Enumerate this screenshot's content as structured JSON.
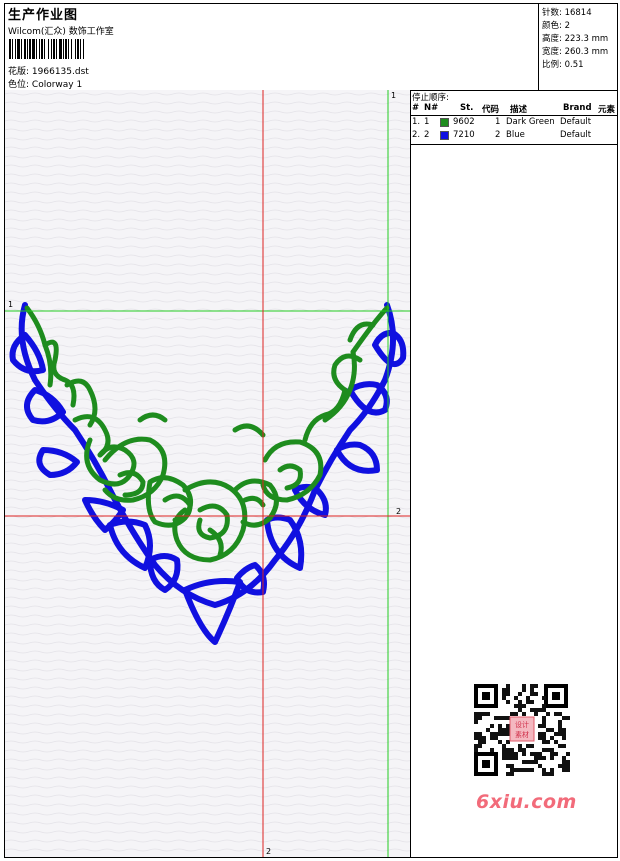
{
  "header": {
    "title": "生产作业图",
    "company": "Wilcom(汇众) 数饰工作室",
    "design_label": "花版:",
    "design_value": "1966135.dst",
    "colorway_label": "色位:",
    "colorway_value": "Colorway 1"
  },
  "stats": {
    "stitches_label": "针数:",
    "stitches_value": "16814",
    "colors_label": "颜色:",
    "colors_value": "2",
    "height_label": "高度:",
    "height_value": "223.3 mm",
    "width_label": "宽度:",
    "width_value": "260.3 mm",
    "scale_label": "比例:",
    "scale_value": "0.51"
  },
  "stop_sequence": {
    "label": "停止顺序:",
    "columns": [
      "#",
      "N#",
      "St.",
      "代码",
      "描述",
      "Brand",
      "元素"
    ],
    "rows": [
      {
        "num": "1.",
        "needle": "1",
        "color": "#1e8c1e",
        "stitch": "9602",
        "code": "1",
        "desc": "Dark Green",
        "brand": "Default"
      },
      {
        "num": "2.",
        "needle": "2",
        "color": "#1010e0",
        "stitch": "7210",
        "code": "2",
        "desc": "Blue",
        "brand": "Default"
      }
    ]
  },
  "guides": {
    "vertical_green": "1",
    "horizontal_green": "1",
    "horizontal_red": "2",
    "vertical_red": "2"
  },
  "watermark": "6xiu.com",
  "qr_badge": "设计素材",
  "colors": {
    "green_thread": "#1e8c1e",
    "blue_thread": "#1010e0",
    "guide_green": "#22cc22",
    "guide_red": "#dd2222"
  }
}
